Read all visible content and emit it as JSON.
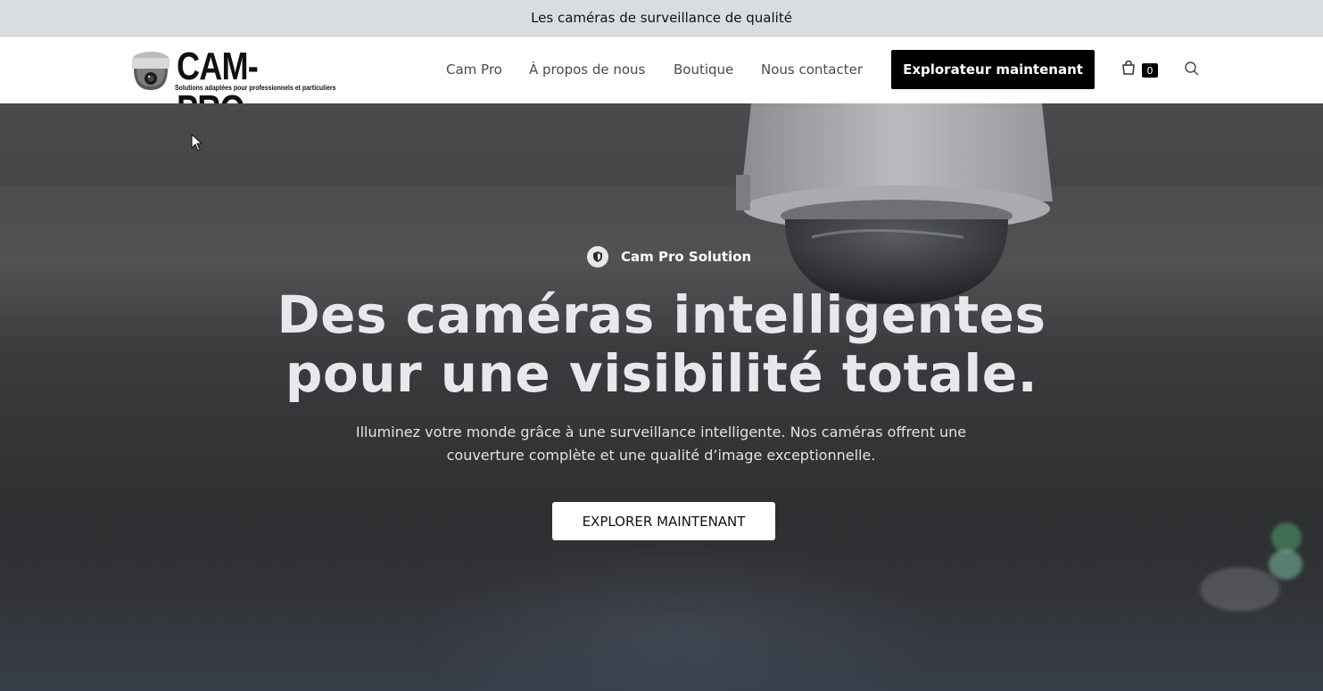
{
  "topbar": {
    "text": "Les caméras de surveillance de qualité"
  },
  "logo": {
    "word": "CAM-PRO",
    "tagline": "Solutions adaptées pour professionnels et particuliers"
  },
  "nav": {
    "items": [
      {
        "label": "Cam Pro"
      },
      {
        "label": "À propos de nous"
      },
      {
        "label": "Boutique"
      },
      {
        "label": "Nous contacter"
      }
    ],
    "cta_label": "Explorateur maintenant",
    "cart_count": "0",
    "cart_icon": "shopping-bag-icon",
    "search_icon": "search-icon"
  },
  "hero": {
    "badge_icon": "shield-icon",
    "badge_label": "Cam Pro Solution",
    "headline_line1": "Des caméras intelligentes",
    "headline_line2": "pour une visibilité totale.",
    "subtext_line1": "Illuminez votre monde grâce à une surveillance intelligente. Nos caméras offrent une",
    "subtext_line2": "couverture complète et une qualité d’image exceptionnelle.",
    "button_label": "EXPLORER MAINTENANT"
  },
  "colors": {
    "topbar_bg": "#d9dde2",
    "cta_bg": "#000000",
    "hero_overlay": "#3b3c3e",
    "headline": "#e7e8ec"
  }
}
